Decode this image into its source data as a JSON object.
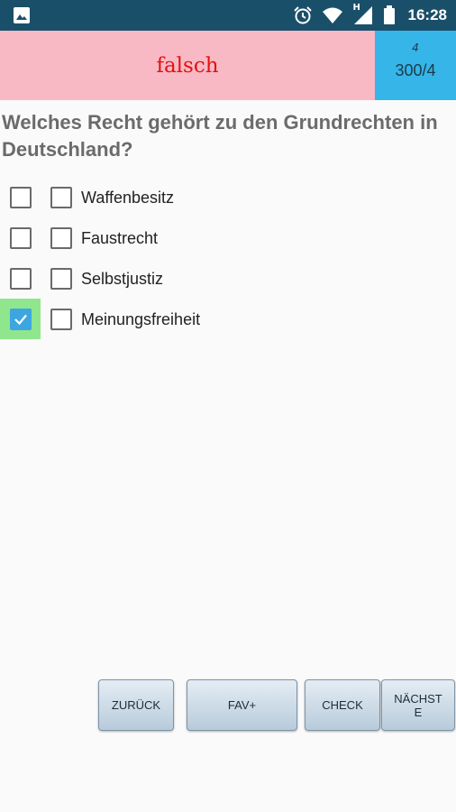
{
  "status_bar": {
    "time": "16:28",
    "network_label": "H",
    "icons": [
      "image-icon",
      "alarm-icon",
      "wifi-icon",
      "signal-icon",
      "battery-icon"
    ]
  },
  "result": {
    "text": "falsch",
    "color": "#e31010",
    "background": "#f8b9c4"
  },
  "counter": {
    "small": "4",
    "main": "300/4",
    "background": "#35b5e8"
  },
  "question": "Welches Recht gehört zu den Grundrechten in Deutschland?",
  "answers": [
    {
      "label": "Waffenbesitz",
      "marked_correct": false,
      "selected": false
    },
    {
      "label": "Faustrecht",
      "marked_correct": false,
      "selected": false
    },
    {
      "label": "Selbstjustiz",
      "marked_correct": false,
      "selected": false
    },
    {
      "label": "Meinungsfreiheit",
      "marked_correct": true,
      "selected": false
    }
  ],
  "buttons": {
    "back": "ZURÜCK",
    "fav": "FAV+",
    "check": "CHECK",
    "next_line1": "NÄCHST",
    "next_line2": "E"
  }
}
